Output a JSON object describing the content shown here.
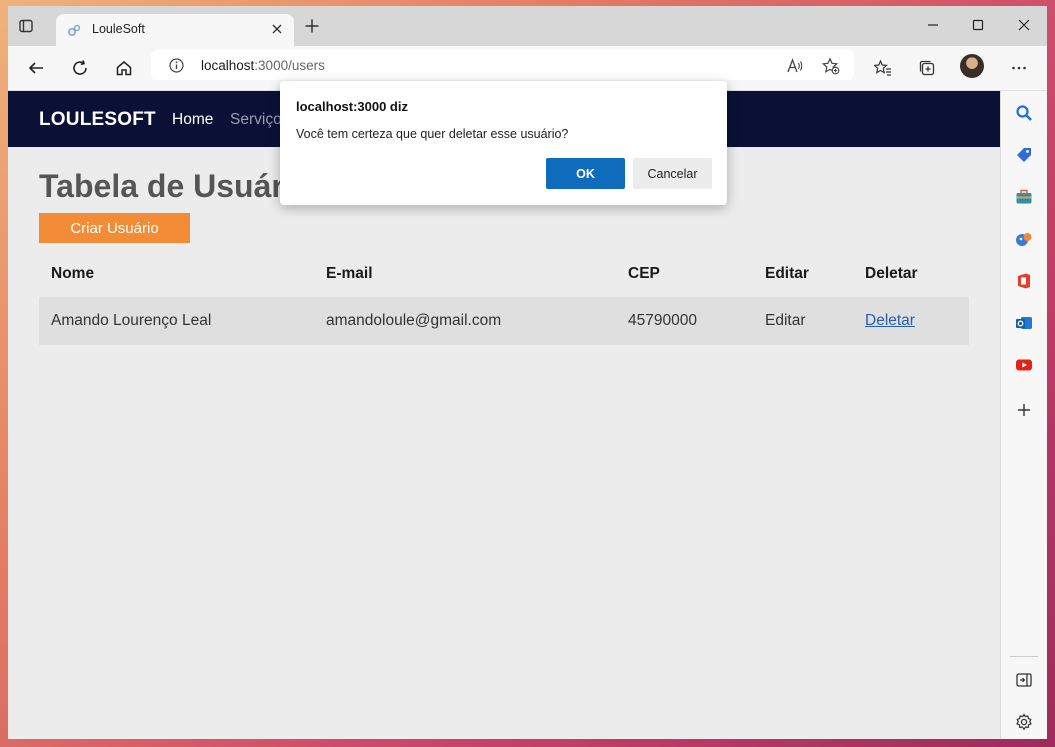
{
  "browser": {
    "tab_title": "LouleSoft",
    "url_host": "localhost",
    "url_path": ":3000/users"
  },
  "site": {
    "brand": "LOULESOFT",
    "nav": [
      {
        "label": "Home"
      },
      {
        "label": "Serviço"
      }
    ]
  },
  "page": {
    "title": "Tabela de Usuário",
    "create_button": "Criar Usuário"
  },
  "table": {
    "headers": [
      "Nome",
      "E-mail",
      "CEP",
      "Editar",
      "Deletar"
    ],
    "rows": [
      {
        "nome": "Amando Lourenço Leal",
        "email": "amandoloule@gmail.com",
        "cep": "45790000",
        "editar": "Editar",
        "deletar": "Deletar"
      }
    ]
  },
  "dialog": {
    "title": "localhost:3000 diz",
    "message": "Você tem certeza que quer deletar esse usuário?",
    "ok": "OK",
    "cancel": "Cancelar"
  },
  "colors": {
    "site_nav": "#0b1136",
    "accent_button": "#f28c36",
    "dialog_ok": "#0f6cbd",
    "link": "#2a5ea8"
  },
  "icons": {
    "sidebar": [
      "search-icon",
      "tag-icon",
      "briefcase-icon",
      "games-icon",
      "office-icon",
      "outlook-icon",
      "youtube-icon",
      "add-icon",
      "sidebar-toggle-icon",
      "settings-icon"
    ]
  }
}
